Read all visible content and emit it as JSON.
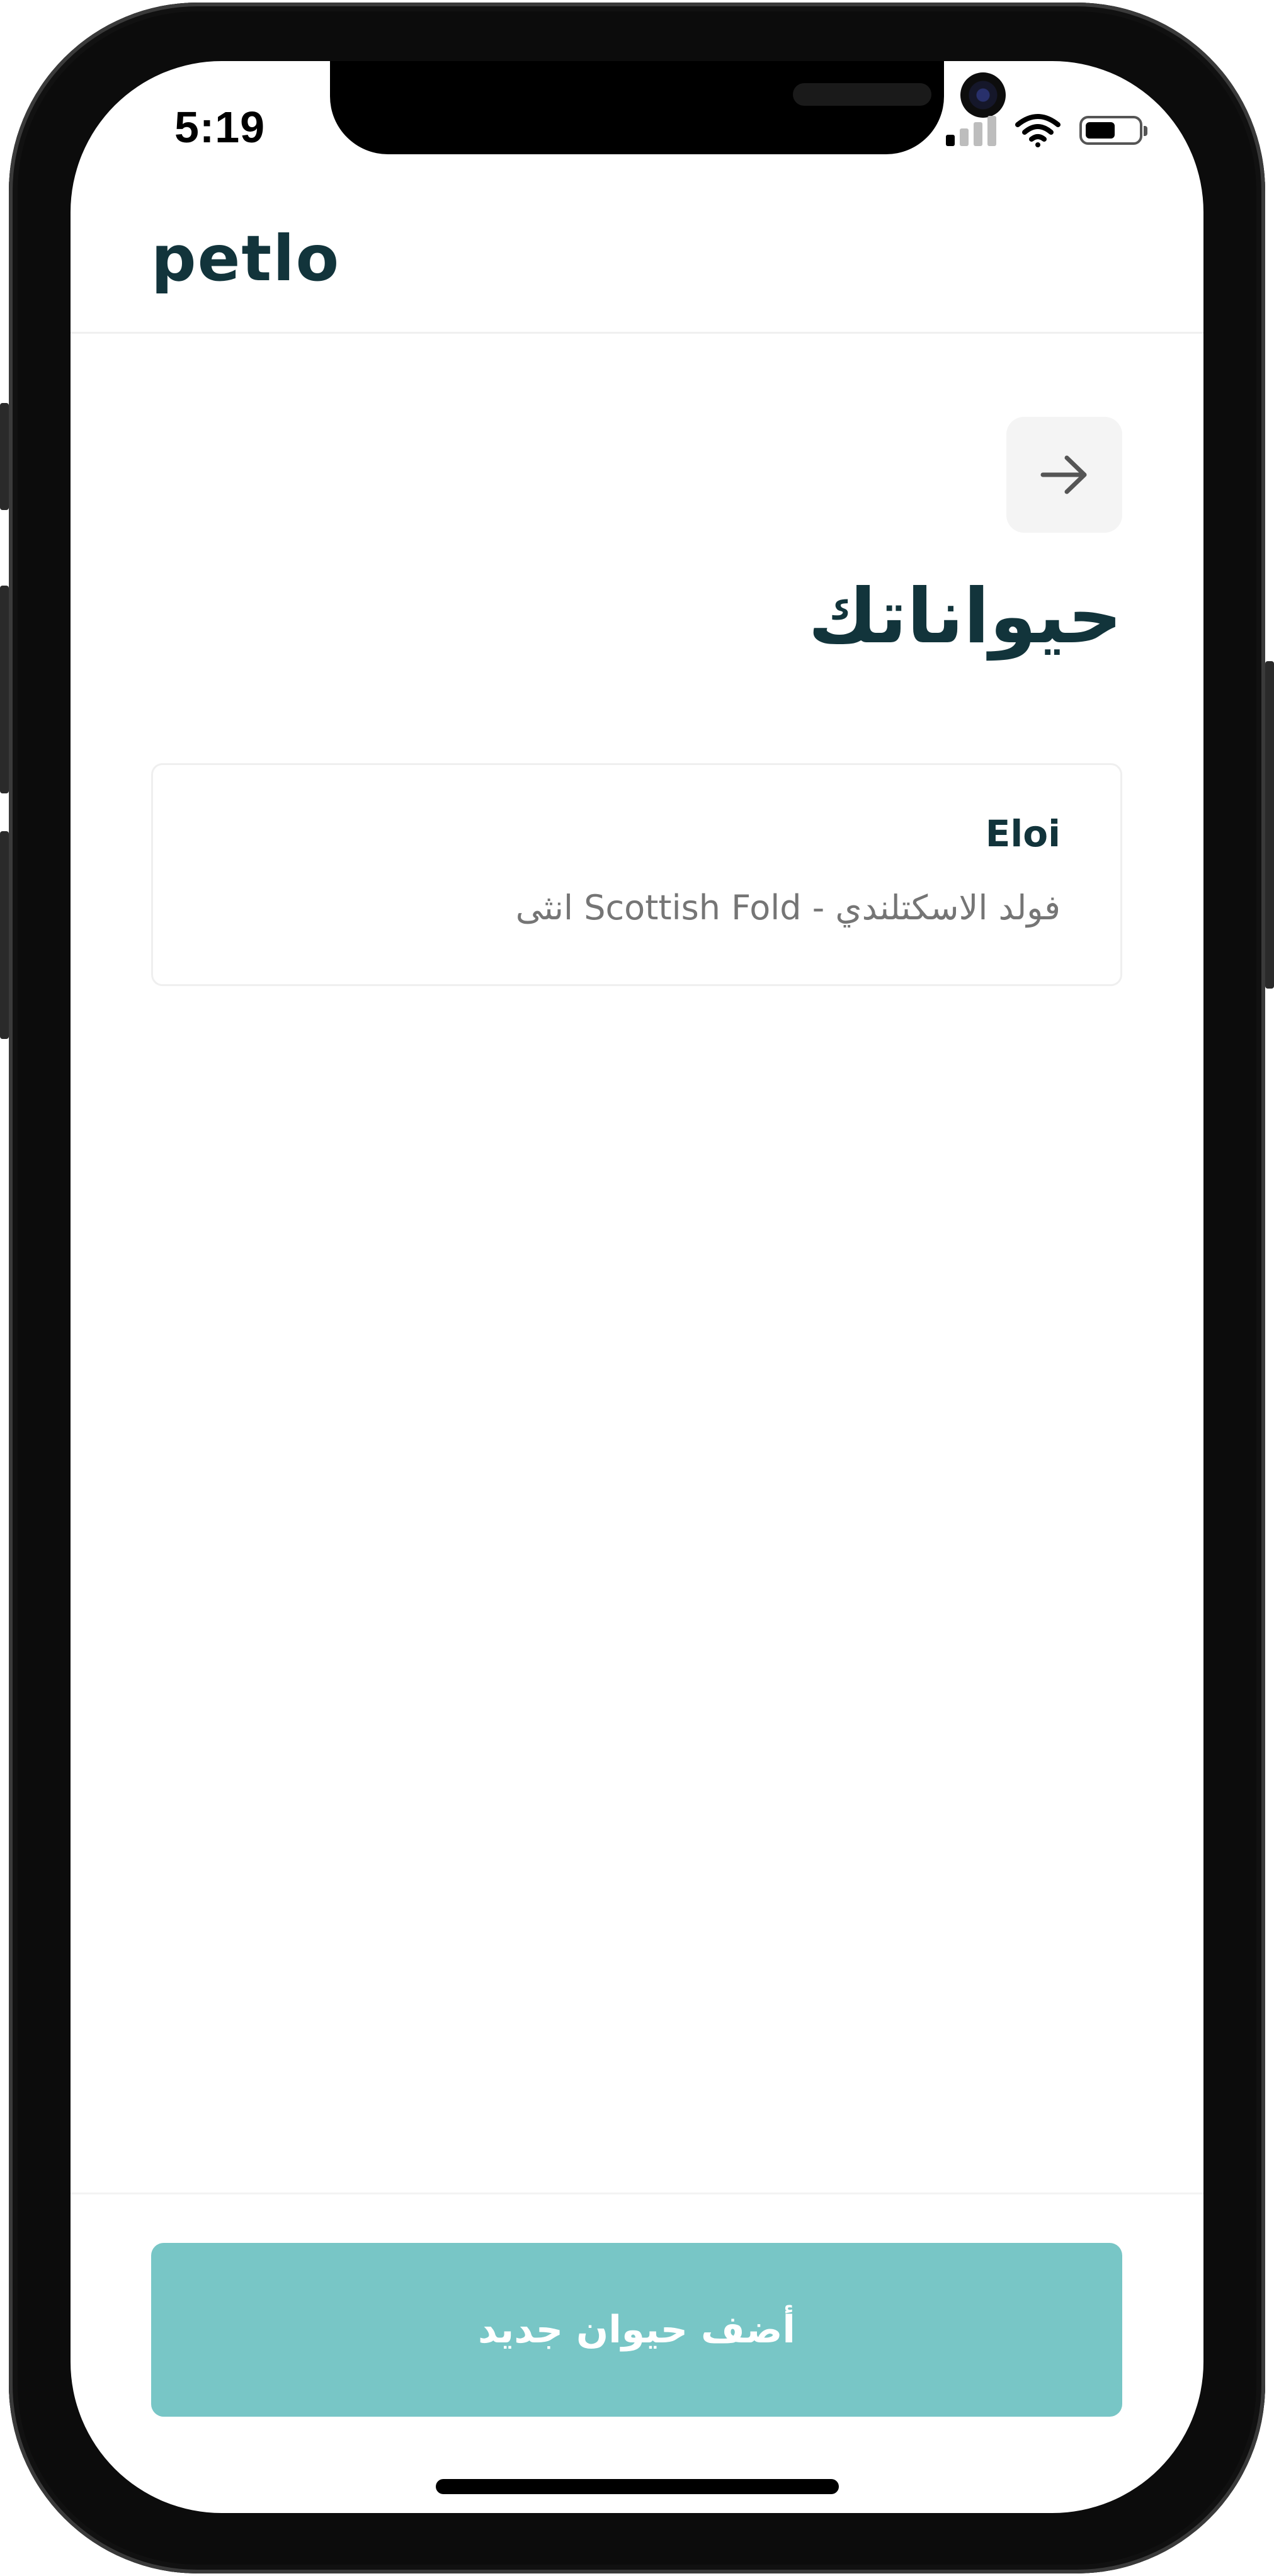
{
  "status_bar": {
    "time": "5:19",
    "icons": [
      "cellular-signal-icon",
      "wifi-icon",
      "battery-icon"
    ],
    "signal_bars_active": 1,
    "signal_bars_total": 4,
    "battery_level": 0.55
  },
  "header": {
    "logo": "petlo"
  },
  "nav": {
    "back_icon": "arrow-right-icon"
  },
  "page": {
    "title": "حيواناتك"
  },
  "pets": [
    {
      "name": "Eloi",
      "details": "فولد الاسكتلندي - Scottish Fold انثى"
    }
  ],
  "footer": {
    "add_button_label": "أضف حيوان جديد"
  },
  "colors": {
    "brand_dark": "#12343b",
    "accent": "#78c6c6",
    "muted_text": "#757575",
    "card_border": "#efefef",
    "back_button_bg": "#f4f4f4"
  }
}
